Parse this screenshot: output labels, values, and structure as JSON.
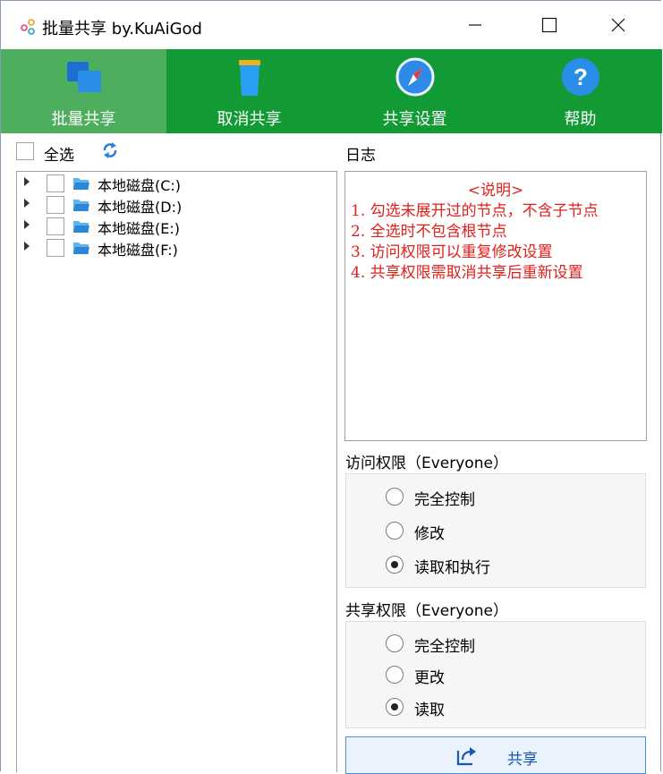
{
  "window": {
    "title": "批量共享 by.KuAiGod",
    "controls": {
      "minimize": "minimize-icon",
      "maximize": "maximize-icon",
      "close": "close-icon"
    }
  },
  "toolbar": {
    "background": "#129a35",
    "active_background": "#4daf5e",
    "items": [
      {
        "label": "批量共享",
        "icon": "windows-icon",
        "active": true
      },
      {
        "label": "取消共享",
        "icon": "trash-icon",
        "active": false
      },
      {
        "label": "共享设置",
        "icon": "compass-icon",
        "active": false
      },
      {
        "label": "帮助",
        "icon": "help-icon",
        "active": false
      }
    ]
  },
  "left": {
    "select_all_label": "全选",
    "refresh_icon": "refresh-icon",
    "drives": [
      {
        "label": "本地磁盘(C:)",
        "checked": false
      },
      {
        "label": "本地磁盘(D:)",
        "checked": false
      },
      {
        "label": "本地磁盘(E:)",
        "checked": false
      },
      {
        "label": "本地磁盘(F:)",
        "checked": false
      }
    ]
  },
  "log": {
    "label": "日志",
    "heading": "<说明>",
    "lines": [
      "1. 勾选未展开过的节点，不含子节点",
      "2. 全选时不包含根节点",
      "3. 访问权限可以重复修改设置",
      "4. 共享权限需取消共享后重新设置"
    ],
    "text_color": "#e0201c"
  },
  "access": {
    "label": "访问权限（Everyone）",
    "options": [
      {
        "label": "完全控制",
        "selected": false
      },
      {
        "label": "修改",
        "selected": false
      },
      {
        "label": "读取和执行",
        "selected": true
      }
    ]
  },
  "share_perm": {
    "label": "共享权限（Everyone）",
    "options": [
      {
        "label": "完全控制",
        "selected": false
      },
      {
        "label": "更改",
        "selected": false
      },
      {
        "label": "读取",
        "selected": true
      }
    ]
  },
  "share_button": {
    "label": "共享",
    "icon": "share-icon"
  }
}
